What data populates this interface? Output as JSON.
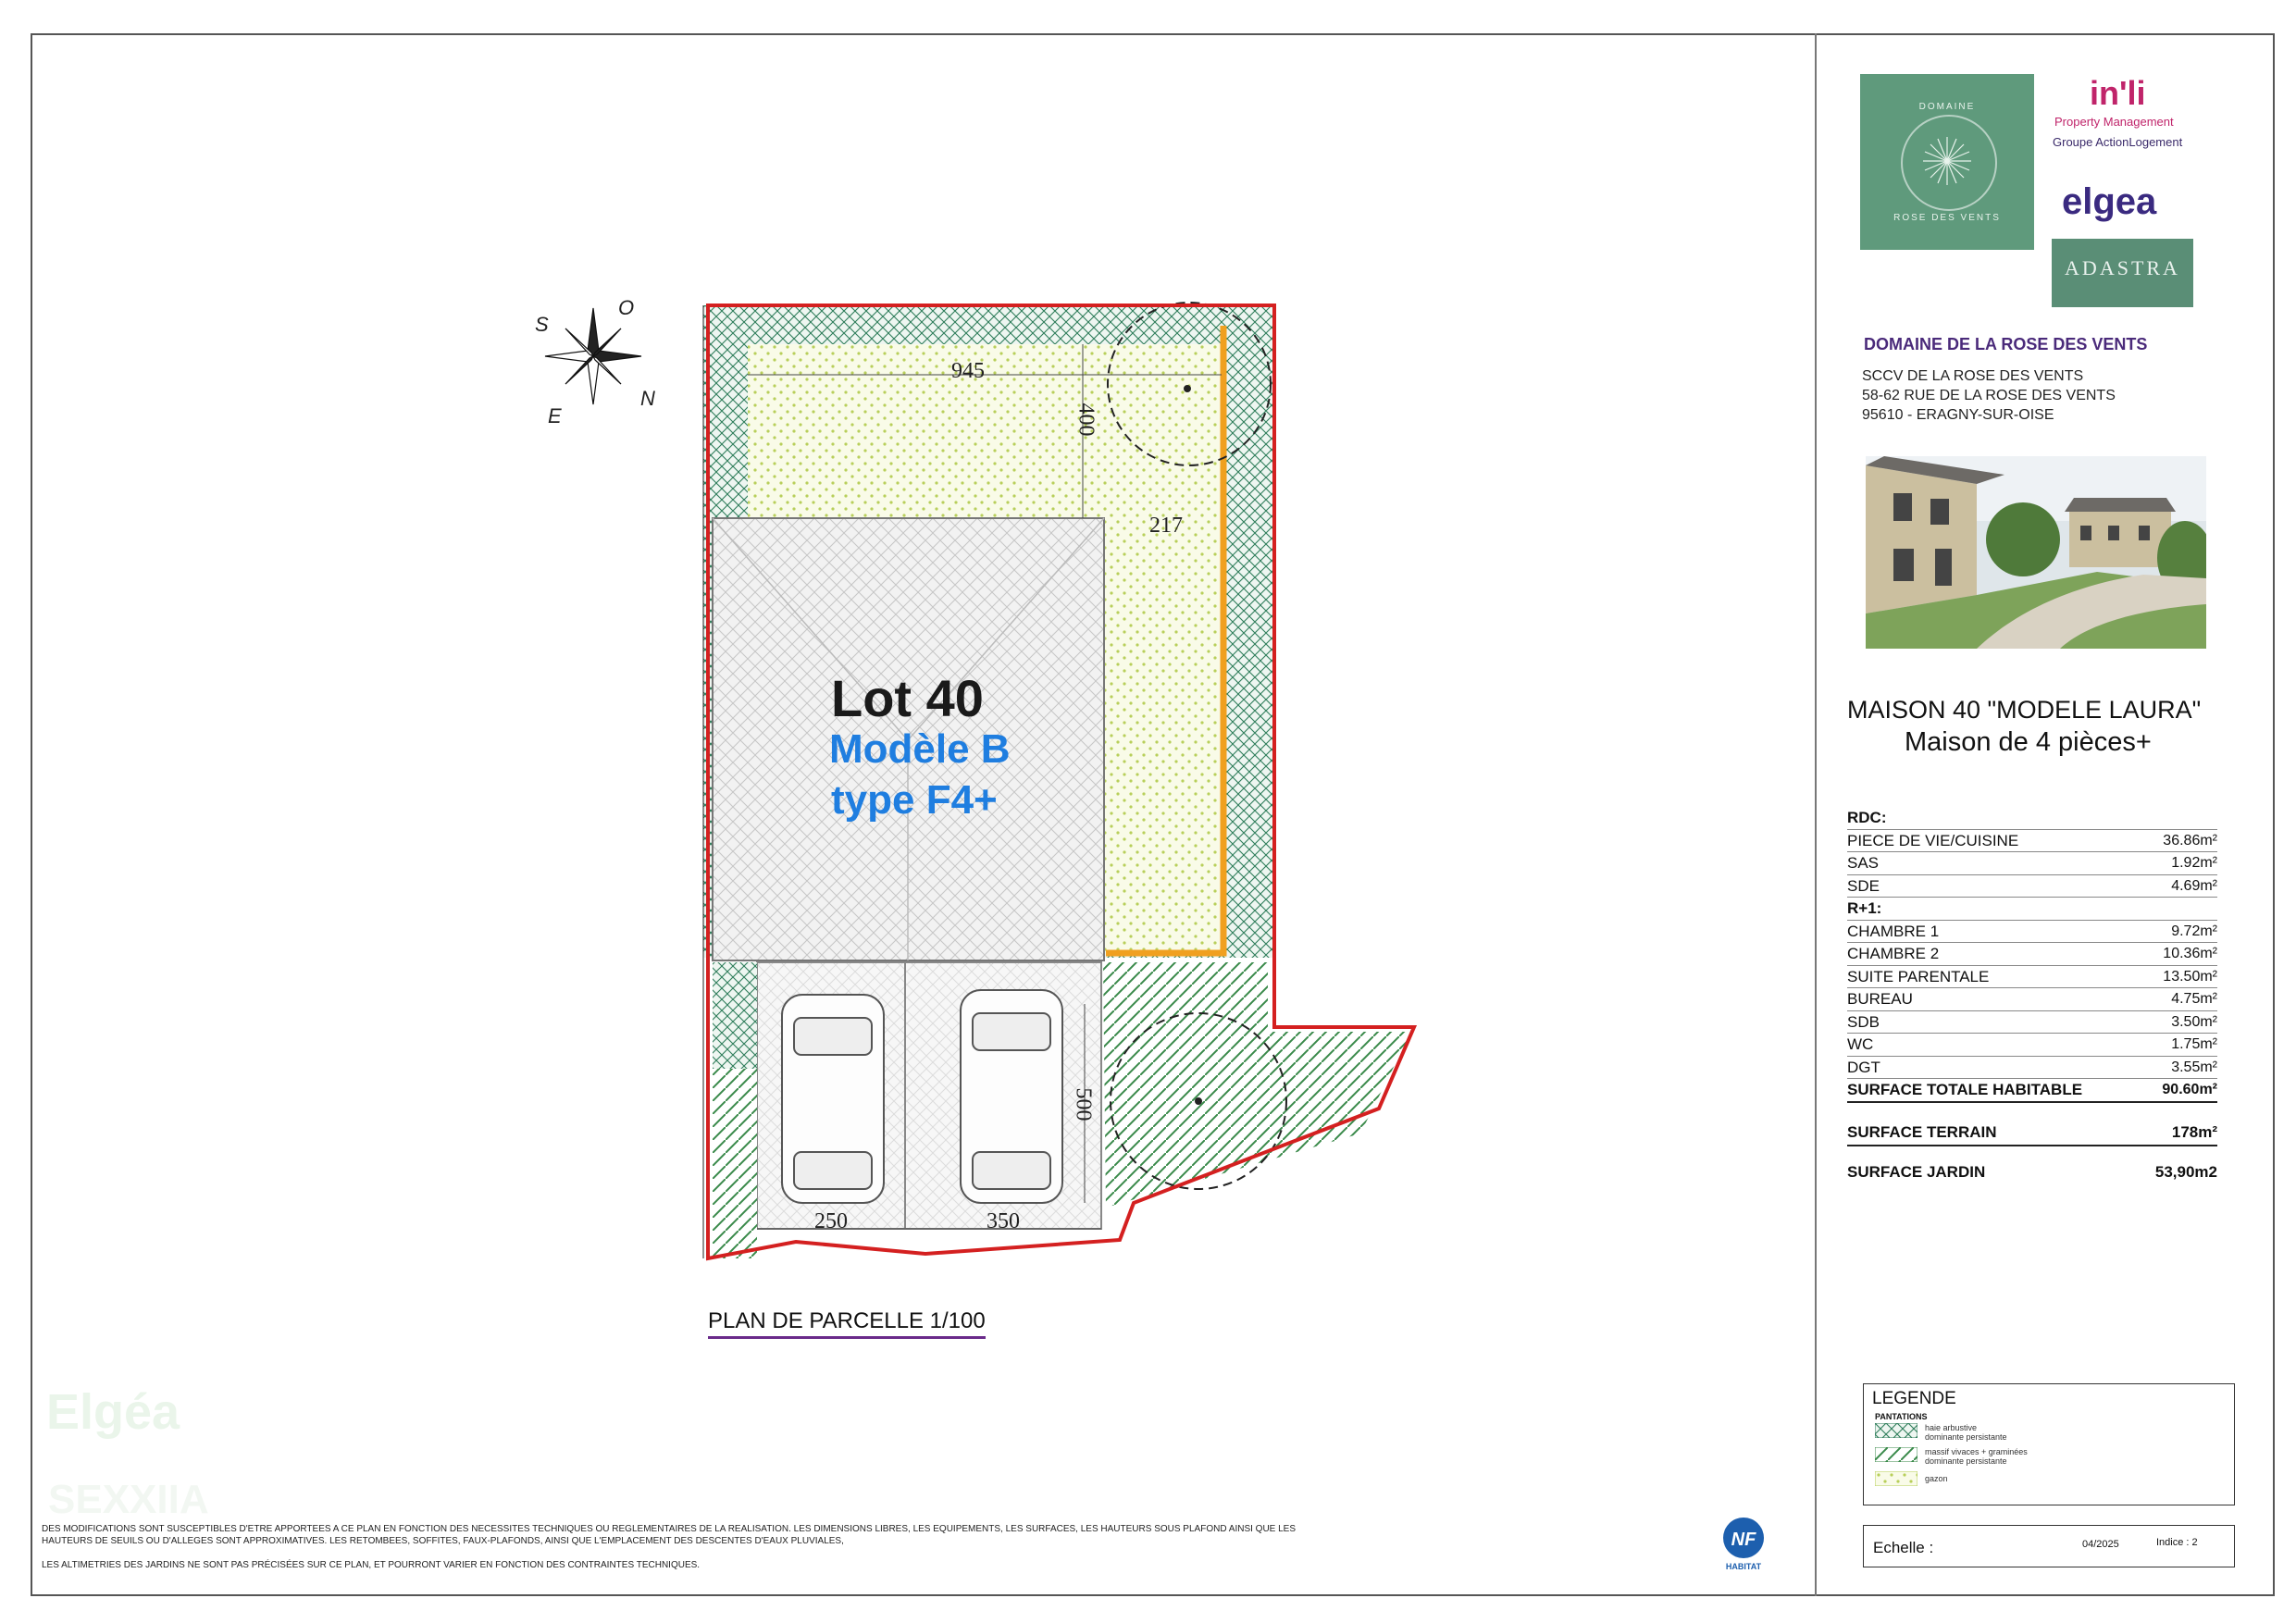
{
  "plan": {
    "lot_title": "Lot 40",
    "lot_model": "Modèle B",
    "lot_type": "type F4+",
    "caption": "PLAN DE PARCELLE 1/100",
    "dimensions": {
      "garden_width": "945",
      "garden_depth": "400",
      "side_gap": "217",
      "parking_depth": "500",
      "parking_left_width": "250",
      "parking_right_width": "350"
    },
    "compass": {
      "s": "S",
      "o": "O",
      "e": "E",
      "n": "N"
    }
  },
  "header": {
    "logos": {
      "domaine_top": "DOMAINE",
      "domaine_bottom": "ROSE DES VENTS",
      "inli": "in'li",
      "inli_line1": "Property Management",
      "inli_line2": "Groupe ActionLogement",
      "elgea": "elgea",
      "adastra": "ADASTRA"
    },
    "project_name": "DOMAINE DE LA ROSE DES VENTS",
    "address": [
      "SCCV DE LA ROSE DES VENTS",
      "58-62 RUE DE LA ROSE DES VENTS",
      "95610 - ERAGNY-SUR-OISE"
    ]
  },
  "house": {
    "title": "MAISON 40 \"MODELE LAURA\"",
    "subtitle": "Maison de 4 pièces+"
  },
  "surfaces": {
    "rdc_label": "RDC:",
    "rdc": [
      {
        "name": "PIECE DE VIE/CUISINE",
        "value": "36.86m²"
      },
      {
        "name": "SAS",
        "value": "1.92m²"
      },
      {
        "name": "SDE",
        "value": "4.69m²"
      }
    ],
    "r1_label": "R+1:",
    "r1": [
      {
        "name": "CHAMBRE 1",
        "value": "9.72m²"
      },
      {
        "name": "CHAMBRE 2",
        "value": "10.36m²"
      },
      {
        "name": "SUITE PARENTALE",
        "value": "13.50m²"
      },
      {
        "name": "BUREAU",
        "value": "4.75m²"
      },
      {
        "name": "SDB",
        "value": "3.50m²"
      },
      {
        "name": "WC",
        "value": "1.75m²"
      },
      {
        "name": "DGT",
        "value": "3.55m²"
      }
    ],
    "total_label": "SURFACE TOTALE HABITABLE",
    "total_value": "90.60m²",
    "terrain_label": "SURFACE TERRAIN",
    "terrain_value": "178m²",
    "jardin_label": "SURFACE JARDIN",
    "jardin_value": "53,90m2"
  },
  "legend": {
    "title": "LEGENDE",
    "section": "PANTATIONS",
    "items": [
      {
        "label1": "haie arbustive",
        "label2": "dominante persistante"
      },
      {
        "label1": "massif vivaces + graminées",
        "label2": "dominante persistante"
      },
      {
        "label1": "gazon",
        "label2": ""
      }
    ]
  },
  "footer": {
    "echelle_label": "Echelle :",
    "date": "04/2025",
    "indice": "Indice : 2",
    "nf_label": "NF",
    "nf_sub": "HABITAT",
    "note1": "DES MODIFICATIONS SONT SUSCEPTIBLES D'ETRE APPORTEES A CE PLAN EN FONCTION DES NECESSITES TECHNIQUES OU REGLEMENTAIRES DE LA REALISATION. LES DIMENSIONS LIBRES, LES EQUIPEMENTS, LES SURFACES, LES HAUTEURS SOUS PLAFOND AINSI QUE LES HAUTEURS DE SEUILS OU D'ALLEGES SONT APPROXIMATIVES. LES RETOMBEES, SOFFITES, FAUX-PLAFONDS, AINSI QUE L'EMPLACEMENT DES DESCENTES D'EAUX PLUVIALES,",
    "note2": "LES ALTIMETRIES DES JARDINS NE SONT PAS PRÉCISÉES SUR CE PLAN, ET POURRONT VARIER EN FONCTION DES CONTRAINTES TECHNIQUES.",
    "watermark1": "Elgéa",
    "watermark2": "SEXXIIA"
  },
  "colors": {
    "boundary": "#d42020",
    "hedge": "#2e7d5a",
    "lawn_dot": "#b8cf5a",
    "lawn_bg": "#f9fbe8",
    "fence": "#f0a020",
    "brand_purple": "#4a2a7a",
    "brand_green": "#5f9a7c",
    "model_blue": "#1f7ee0"
  }
}
